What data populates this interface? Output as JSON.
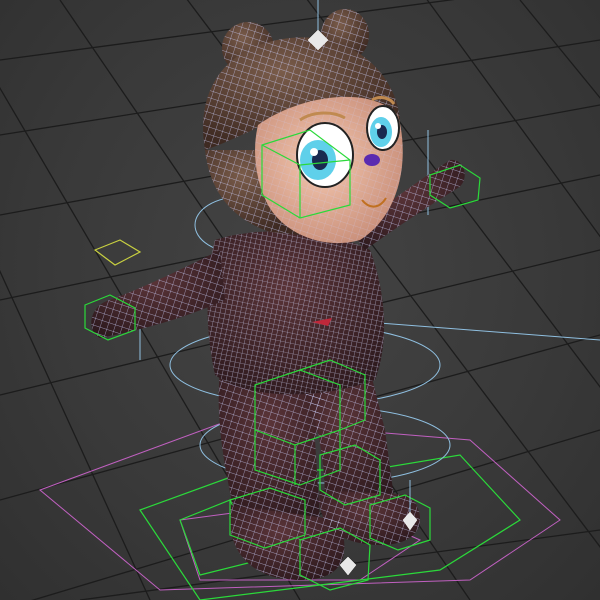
{
  "viewport": {
    "view": "perspective",
    "colors": {
      "background": "#3a3a3a",
      "grid": "#1c1c1c",
      "wireframe": "#cfd3ff",
      "body": "#4a2a2e",
      "hair": "#5a4034",
      "skin": "#e8b39b",
      "eye": "#5fd0ea",
      "controls_green": "#2bd93a",
      "controls_yellow": "#c8d040",
      "controls_pink": "#c060c0",
      "controls_blue": "#8fbfe0",
      "controls_white": "#e8e8e8"
    },
    "character": {
      "name_icon": "bear-character-rig-icon",
      "pose": "T-pose"
    }
  }
}
